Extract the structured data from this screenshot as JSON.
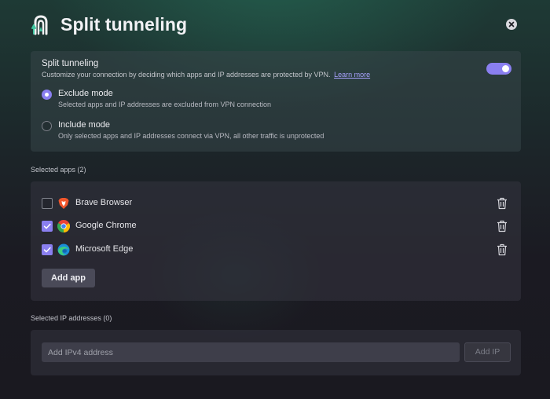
{
  "header": {
    "title": "Split tunneling",
    "logo_icon": "vpn-shield-logo-icon",
    "close_icon": "close-icon"
  },
  "split_tunneling": {
    "title": "Split tunneling",
    "description": "Customize your connection by deciding which apps and IP addresses are protected by VPN.",
    "learn_more": "Learn more",
    "enabled": true,
    "modes": [
      {
        "label": "Exclude mode",
        "description": "Selected apps and IP addresses are excluded from VPN connection",
        "selected": true
      },
      {
        "label": "Include mode",
        "description": "Only selected apps and IP addresses connect via VPN, all other traffic is unprotected",
        "selected": false
      }
    ]
  },
  "apps_section": {
    "label": "Selected apps (2)",
    "items": [
      {
        "name": "Brave Browser",
        "checked": false,
        "icon": "brave-browser-icon"
      },
      {
        "name": "Google Chrome",
        "checked": true,
        "icon": "google-chrome-icon"
      },
      {
        "name": "Microsoft Edge",
        "checked": true,
        "icon": "microsoft-edge-icon"
      }
    ],
    "add_button": "Add app",
    "delete_icon": "trash-icon"
  },
  "ip_section": {
    "label": "Selected IP addresses (0)",
    "input_placeholder": "Add IPv4 address",
    "input_value": "",
    "add_button": "Add IP"
  },
  "colors": {
    "accent": "#8a7ff0",
    "link": "#a9a3ff",
    "background_top": "#1e3a35",
    "background_bottom": "#1a1920"
  }
}
